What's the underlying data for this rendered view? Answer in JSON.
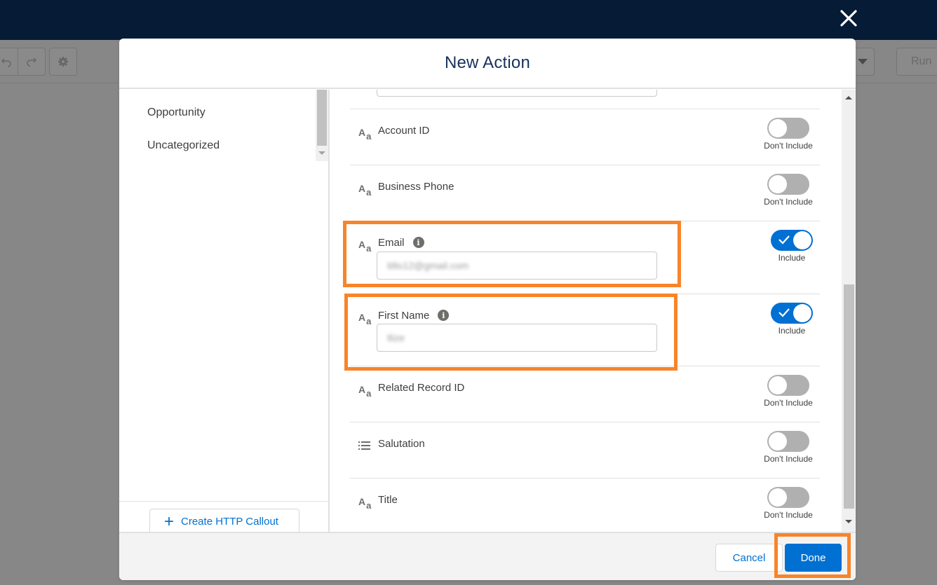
{
  "background": {
    "toolbar": {
      "undo_icon": "undo-icon",
      "redo_icon": "redo-icon",
      "settings_icon": "gear-icon",
      "dropdown_icon": "caret-down-icon",
      "run_label": "Run"
    }
  },
  "modal": {
    "title": "New Action",
    "close_icon": "close-icon",
    "categories": [
      {
        "label": "Opportunity"
      },
      {
        "label": "Uncategorized"
      }
    ],
    "create_http_callout_label": "Create HTTP Callout",
    "fields": [
      {
        "label": "Account ID",
        "type_icon": "text-type-icon",
        "info": false,
        "has_input": false,
        "value": "",
        "include": false,
        "toggle_label": "Don't Include"
      },
      {
        "label": "Business Phone",
        "type_icon": "text-type-icon",
        "info": false,
        "has_input": false,
        "value": "",
        "include": false,
        "toggle_label": "Don't Include"
      },
      {
        "label": "Email",
        "type_icon": "text-type-icon",
        "info": true,
        "has_input": true,
        "value": "ti8o12@gmail.com",
        "include": true,
        "toggle_label": "Include"
      },
      {
        "label": "First Name",
        "type_icon": "text-type-icon",
        "info": true,
        "has_input": true,
        "value": "tlize",
        "include": true,
        "toggle_label": "Include"
      },
      {
        "label": "Related Record ID",
        "type_icon": "text-type-icon",
        "info": false,
        "has_input": false,
        "value": "",
        "include": false,
        "toggle_label": "Don't Include"
      },
      {
        "label": "Salutation",
        "type_icon": "picklist-icon",
        "info": false,
        "has_input": false,
        "value": "",
        "include": false,
        "toggle_label": "Don't Include"
      },
      {
        "label": "Title",
        "type_icon": "text-type-icon",
        "info": false,
        "has_input": false,
        "value": "",
        "include": false,
        "toggle_label": "Don't Include"
      }
    ],
    "footer": {
      "cancel_label": "Cancel",
      "done_label": "Done"
    }
  },
  "colors": {
    "brand_blue": "#0070d2",
    "header_navy": "#061b36",
    "highlight_orange": "#f8842a",
    "toggle_off": "#b0b0b0"
  }
}
